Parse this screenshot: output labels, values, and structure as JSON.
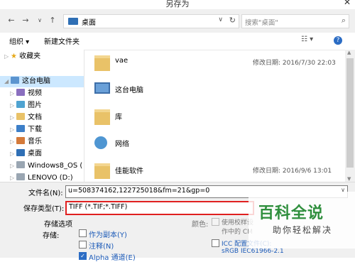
{
  "window": {
    "title": "另存为"
  },
  "nav": {
    "back_icon": "←",
    "forward_icon": "→",
    "dropdown_icon": "∨",
    "up_icon": "↑",
    "address": "桌面",
    "refresh_icon": "↻",
    "search_placeholder": "搜索\"桌面\"",
    "search_icon": "⌕"
  },
  "toolbar": {
    "organize_label": "组织 ▾",
    "new_folder_label": "新建文件夹",
    "view_icon": "☷ ▾",
    "help_icon": "?"
  },
  "tree": {
    "favorites": "收藏夹",
    "this_pc": "这台电脑",
    "items": [
      "视频",
      "图片",
      "文档",
      "下载",
      "音乐",
      "桌面",
      "Windows8_OS (",
      "LENOVO (D:)"
    ]
  },
  "files": [
    {
      "name": "vae",
      "date": "修改日期: 2016/7/30 22:03",
      "icon": "folder-icon"
    },
    {
      "name": "这台电脑",
      "date": "",
      "icon": "computer-icon"
    },
    {
      "name": "库",
      "date": "",
      "icon": "library-icon"
    },
    {
      "name": "网络",
      "date": "",
      "icon": "network-icon"
    },
    {
      "name": "佳能软件",
      "date": "修改日期: 2016/9/6 13:01",
      "icon": "folder-icon"
    }
  ],
  "form": {
    "filename_label": "文件名(N):",
    "filename_value": "u=508374162,122725018&fm=21&gp=0",
    "filetype_label": "保存类型(T):",
    "filetype_value": "TIFF (*.TIF;*.TIFF)",
    "save_options_label": "存储选项",
    "storage_label": "存储:",
    "save_as_copy": "作为副本(Y)",
    "notes": "注释(N)",
    "alpha_channel": "Alpha 通道(E)",
    "color_label": "颜色:",
    "use_proof_setup": "使用校样设",
    "proof_line2": "作中的 CM",
    "icc_profile": "ICC 配置文件(C):",
    "icc_value": "sRGB IEC61966-2.1"
  },
  "watermark": {
    "big": "百科全说",
    "small": "助你轻松解决"
  }
}
